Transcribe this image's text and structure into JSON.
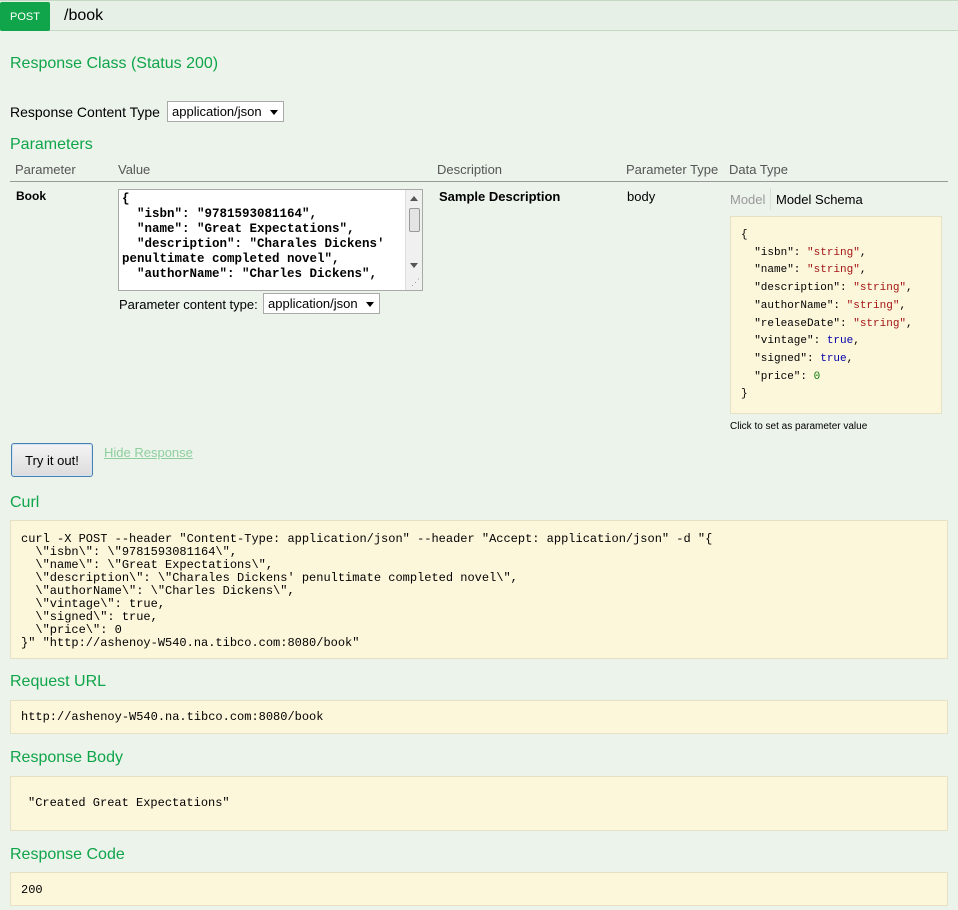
{
  "operation": {
    "method": "POST",
    "path": "/book"
  },
  "response_class": {
    "title": "Response Class (Status 200)"
  },
  "response_content_type": {
    "label": "Response Content Type",
    "selected": "application/json"
  },
  "parameters": {
    "title": "Parameters",
    "columns": [
      "Parameter",
      "Value",
      "Description",
      "Parameter Type",
      "Data Type"
    ],
    "rows": [
      {
        "name": "Book",
        "value_text": "{\n  \"isbn\": \"9781593081164\",\n  \"name\": \"Great Expectations\",\n  \"description\": \"Charales Dickens' penultimate completed novel\",\n  \"authorName\": \"Charles Dickens\",",
        "content_type_label": "Parameter content type:",
        "content_type_selected": "application/json",
        "description": "Sample Description",
        "parameter_type": "body",
        "data_type_tabs": [
          "Model",
          "Model Schema"
        ],
        "schema_fields": [
          {
            "key": "\"isbn\"",
            "value": "\"string\"",
            "kind": "str"
          },
          {
            "key": "\"name\"",
            "value": "\"string\"",
            "kind": "str"
          },
          {
            "key": "\"description\"",
            "value": "\"string\"",
            "kind": "str"
          },
          {
            "key": "\"authorName\"",
            "value": "\"string\"",
            "kind": "str"
          },
          {
            "key": "\"releaseDate\"",
            "value": "\"string\"",
            "kind": "str"
          },
          {
            "key": "\"vintage\"",
            "value": "true",
            "kind": "bool"
          },
          {
            "key": "\"signed\"",
            "value": "true",
            "kind": "bool"
          },
          {
            "key": "\"price\"",
            "value": "0",
            "kind": "num"
          }
        ],
        "schema_hint": "Click to set as parameter value"
      }
    ]
  },
  "actions": {
    "try_label": "Try it out!",
    "hide_label": "Hide Response"
  },
  "curl": {
    "title": "Curl",
    "text": "curl -X POST --header \"Content-Type: application/json\" --header \"Accept: application/json\" -d \"{\n  \\\"isbn\\\": \\\"9781593081164\\\",\n  \\\"name\\\": \\\"Great Expectations\\\",\n  \\\"description\\\": \\\"Charales Dickens' penultimate completed novel\\\",\n  \\\"authorName\\\": \\\"Charles Dickens\\\",\n  \\\"vintage\\\": true,\n  \\\"signed\\\": true,\n  \\\"price\\\": 0\n}\" \"http://ashenoy-W540.na.tibco.com:8080/book\""
  },
  "request_url": {
    "title": "Request URL",
    "value": "http://ashenoy-W540.na.tibco.com:8080/book"
  },
  "response_body": {
    "title": "Response Body",
    "value": "\"Created Great Expectations\""
  },
  "response_code": {
    "title": "Response Code",
    "value": "200"
  },
  "colors": {
    "accent": "#10a54a",
    "page_bg": "#ebf3eb",
    "code_bg": "#fcf6db"
  }
}
